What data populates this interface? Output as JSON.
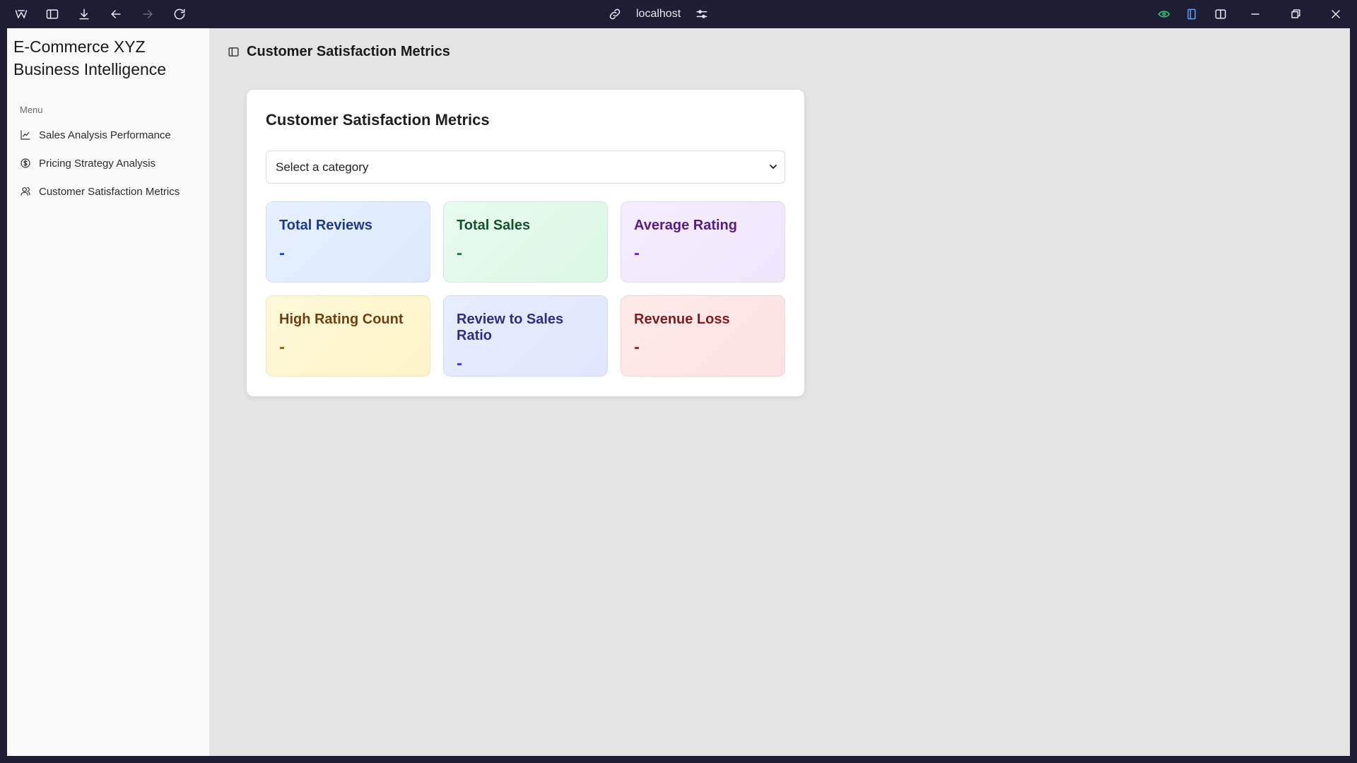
{
  "browser": {
    "url": "localhost",
    "toolbar_icons": [
      "app-logo-icon",
      "sidebar-toggle-icon",
      "download-icon",
      "back-arrow-icon",
      "forward-arrow-icon",
      "reload-icon"
    ],
    "right_icons": [
      "vpn-icon",
      "extension-icon",
      "split-view-icon",
      "minimize-icon",
      "restore-icon",
      "close-icon"
    ]
  },
  "sidebar": {
    "brand_line1": "E-Commerce XYZ",
    "brand_line2": "Business Intelligence",
    "menu_label": "Menu",
    "items": [
      {
        "label": "Sales Analysis Performance",
        "icon": "line-chart-icon"
      },
      {
        "label": "Pricing Strategy Analysis",
        "icon": "dollar-circle-icon"
      },
      {
        "label": "Customer Satisfaction Metrics",
        "icon": "users-icon"
      }
    ]
  },
  "header": {
    "title": "Customer Satisfaction Metrics"
  },
  "card": {
    "title": "Customer Satisfaction Metrics",
    "select_value": "Select a category",
    "metrics": [
      {
        "label": "Total Reviews",
        "value": "-"
      },
      {
        "label": "Total Sales",
        "value": "-"
      },
      {
        "label": "Average Rating",
        "value": "-"
      },
      {
        "label": "High Rating Count",
        "value": "-"
      },
      {
        "label": "Review to Sales Ratio",
        "value": "-"
      },
      {
        "label": "Revenue Loss",
        "value": "-"
      }
    ]
  }
}
